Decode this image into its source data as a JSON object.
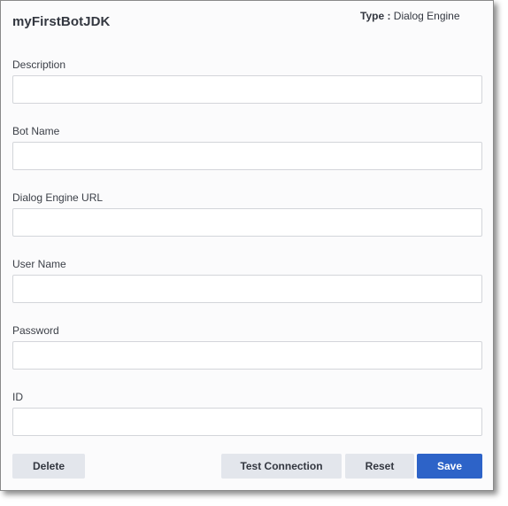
{
  "header": {
    "bot_name": "myFirstBotJDK",
    "type_label": "Type :",
    "type_value": "Dialog Engine"
  },
  "fields": [
    {
      "label": "Description",
      "value": ""
    },
    {
      "label": "Bot Name",
      "value": ""
    },
    {
      "label": "Dialog Engine URL",
      "value": ""
    },
    {
      "label": "User Name",
      "value": ""
    },
    {
      "label": "Password",
      "value": ""
    },
    {
      "label": "ID",
      "value": ""
    }
  ],
  "actions": {
    "delete_label": "Delete",
    "test_connection_label": "Test Connection",
    "reset_label": "Reset",
    "save_label": "Save"
  },
  "colors": {
    "primary": "#2d63c8",
    "secondary": "#e3e6ec",
    "border": "#d3d5da"
  }
}
